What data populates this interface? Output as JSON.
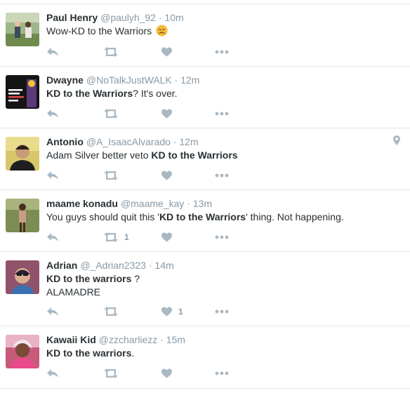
{
  "tweets": [
    {
      "name": "Paul Henry",
      "handle": "@paulyh_92",
      "time": "10m",
      "text_parts": [
        "Wow-KD to the Warriors"
      ],
      "emoji": "disappointed-face",
      "retweet_count": "",
      "like_count": ""
    },
    {
      "name": "Dwayne",
      "handle": "@NoTalkJustWALK",
      "time": "12m",
      "text_parts": [
        "KD to the Warriors",
        "? It's over."
      ],
      "retweet_count": "",
      "like_count": ""
    },
    {
      "name": "Antonio",
      "handle": "@A_IsaacAlvarado",
      "time": "12m",
      "text_parts": [
        "Adam Silver better veto ",
        "KD to the Warriors"
      ],
      "has_location": true,
      "retweet_count": "",
      "like_count": ""
    },
    {
      "name": "maame konadu",
      "handle": "@maame_kay",
      "time": "13m",
      "text_parts": [
        "You guys should quit this '",
        "KD to the Warriors",
        "' thing. Not happening."
      ],
      "retweet_count": "1",
      "like_count": ""
    },
    {
      "name": "Adrian",
      "handle": "@_Adrian2323",
      "time": "14m",
      "text_parts": [
        "KD to the warriors",
        " ?"
      ],
      "text_line2": "ALAMADRE",
      "retweet_count": "",
      "like_count": "1"
    },
    {
      "name": "Kawaii Kid",
      "handle": "@zzcharliezz",
      "time": "15m",
      "text_parts": [
        "KD to the warriors",
        "."
      ],
      "retweet_count": "",
      "like_count": ""
    }
  ],
  "separator": "·",
  "icons": {
    "reply": "reply-icon",
    "retweet": "retweet-icon",
    "like": "heart-icon",
    "more": "more-dots-icon",
    "location": "location-pin-icon"
  },
  "colors": {
    "icon_gray": "#aab8c2",
    "meta_gray": "#8899a6",
    "text": "#292f33",
    "divider": "#e1e8ed"
  }
}
